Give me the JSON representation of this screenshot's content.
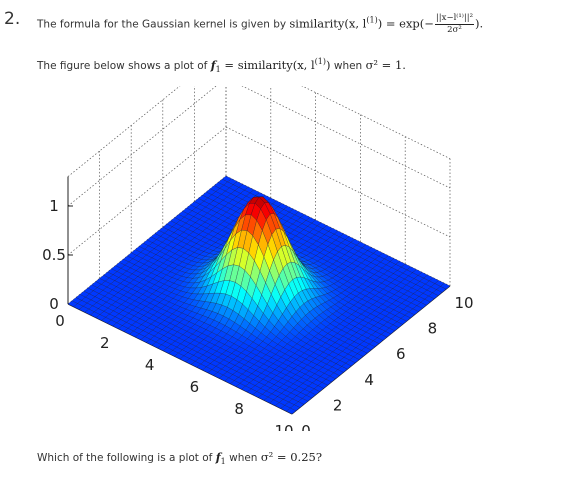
{
  "question": {
    "number": "2.",
    "formula_prefix": "The formula for the Gaussian kernel is given by ",
    "formula_lhs": "similarity(x, l",
    "formula_lhs_sup": "(1)",
    "formula_rhs": ") = exp(−",
    "formula_num": "||x−l⁽¹⁾||²",
    "formula_den": "2σ²",
    "formula_end": ").",
    "figure_prefix": "The figure below shows a plot of ",
    "figure_f": "f",
    "figure_f_sub": "1",
    "figure_eq": " = similarity(x, l",
    "figure_eq_sup": "(1)",
    "figure_eq_end": ")",
    "figure_when": " when ",
    "figure_sigma": "σ² = 1.",
    "bottom_prefix": "Which of the following is a plot of ",
    "bottom_f": "f",
    "bottom_f_sub": "1",
    "bottom_when": " when ",
    "bottom_sigma": "σ² = 0.25?"
  },
  "chart_data": {
    "type": "surface",
    "title": "",
    "function": "exp(-((x1-5)^2 + (x2-5)^2) / (2*sigma^2))",
    "sigma_squared": 1,
    "center": [
      5,
      5
    ],
    "x1_range": [
      0,
      10
    ],
    "x2_range": [
      0,
      10
    ],
    "z_range": [
      0,
      1
    ],
    "x1_ticks": [
      "0",
      "2",
      "4",
      "6",
      "8",
      "10"
    ],
    "x2_ticks": [
      "0",
      "2",
      "4",
      "6",
      "8",
      "10"
    ],
    "z_ticks": [
      "0",
      "0.5",
      "1"
    ],
    "colormap": "jet",
    "grid": true
  }
}
